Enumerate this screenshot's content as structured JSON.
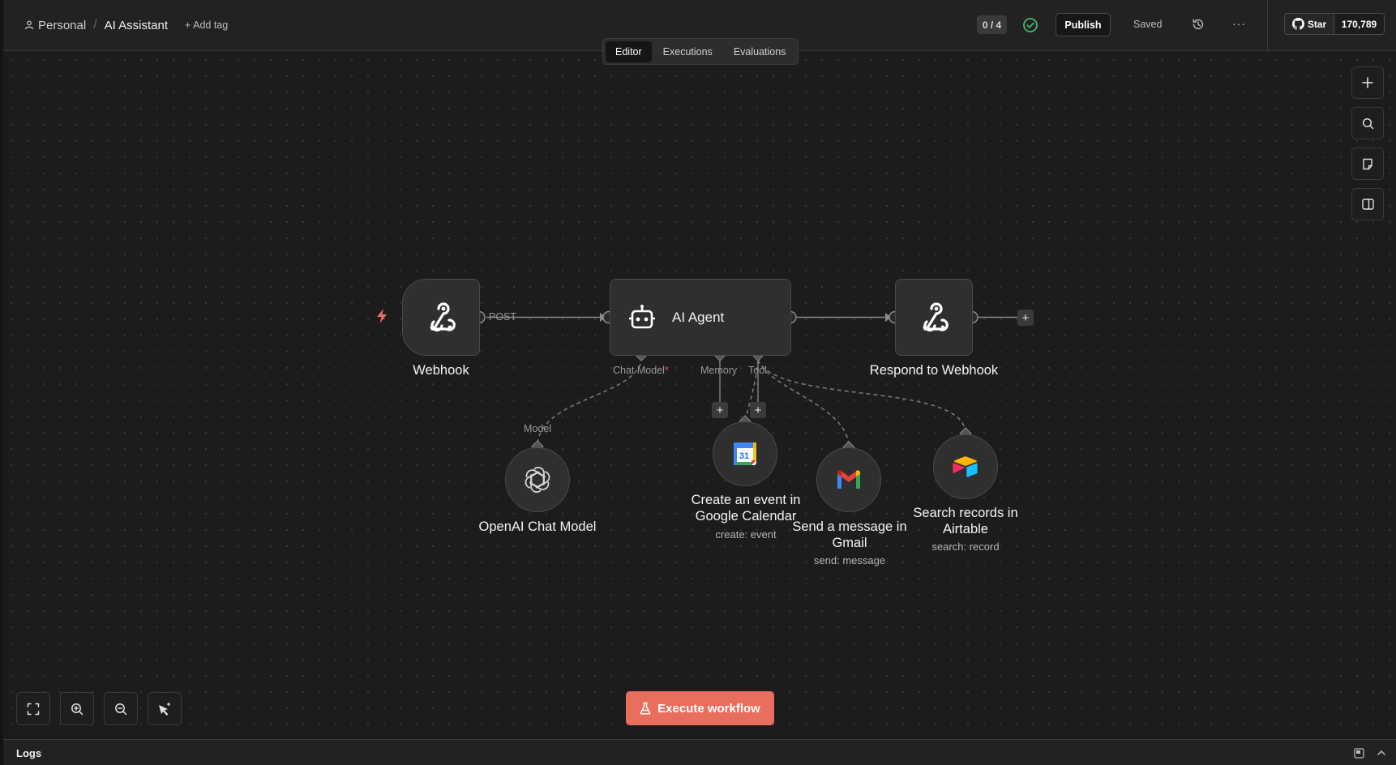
{
  "header": {
    "breadcrumb_project": "Personal",
    "breadcrumb_separator": "/",
    "workflow_name": "AI Assistant",
    "add_tag": "+ Add tag",
    "tabs": [
      {
        "label": "Editor",
        "active": true
      },
      {
        "label": "Executions",
        "active": false
      },
      {
        "label": "Evaluations",
        "active": false
      }
    ],
    "counter": "0 / 4",
    "publish_label": "Publish",
    "save_status": "Saved",
    "more_label": "···",
    "github_star_label": "Star",
    "github_star_count": "170,789"
  },
  "canvas": {
    "nodes": {
      "webhook": {
        "label": "Webhook",
        "icon": "webhook-icon"
      },
      "ai_agent": {
        "label": "AI Agent",
        "icon": "robot-icon"
      },
      "respond": {
        "label": "Respond to Webhook",
        "icon": "webhook-icon"
      },
      "openai": {
        "label": "OpenAI Chat Model",
        "icon": "openai-icon"
      },
      "gcal": {
        "label_line1": "Create an event in",
        "label_line2": "Google Calendar",
        "subtitle": "create: event",
        "icon": "google-calendar-icon"
      },
      "gmail": {
        "label_line1": "Send a message in",
        "label_line2": "Gmail",
        "subtitle": "send: message",
        "icon": "gmail-icon"
      },
      "airtable": {
        "label_line1": "Search records in",
        "label_line2": "Airtable",
        "subtitle": "search: record",
        "icon": "airtable-icon"
      }
    },
    "edge_labels": {
      "webhook_out": "POST",
      "chat_model_port": "Chat Model",
      "required_marker": "*",
      "memory_port": "Memory",
      "tool_port": "Tool",
      "model_port": "Model"
    },
    "gcal_date": "31",
    "plus": "+"
  },
  "actions": {
    "execute_label": "Execute workflow"
  },
  "logs": {
    "title": "Logs"
  },
  "colors": {
    "accent": "#ea6e5d",
    "success": "#3fb870",
    "canvas_bg": "#1c1c1c",
    "node_bg": "#2f2f2f"
  }
}
